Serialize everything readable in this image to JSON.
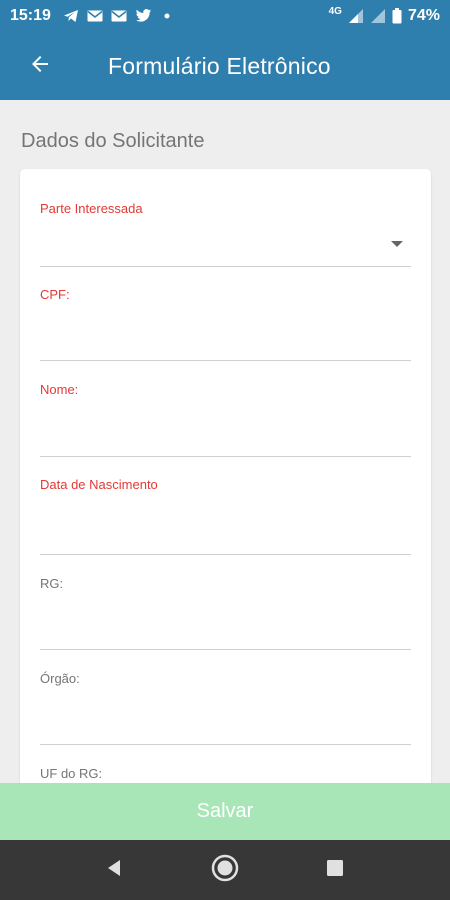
{
  "status_bar": {
    "time": "15:19",
    "network": "4G",
    "battery": "74%",
    "notification_icons": [
      "telegram-icon",
      "mail-icon",
      "mail-icon",
      "twitter-icon",
      "dot-icon"
    ]
  },
  "app_bar": {
    "title": "Formulário Eletrônico",
    "back_icon": "arrow-left-icon",
    "color": "#2f7fae"
  },
  "section": {
    "title": "Dados do Solicitante"
  },
  "fields": [
    {
      "label": "Parte Interessada",
      "value": "",
      "type": "dropdown",
      "required": true
    },
    {
      "label": "CPF:",
      "value": "",
      "type": "text",
      "required": true
    },
    {
      "label": "Nome:",
      "value": "",
      "type": "text",
      "required": true
    },
    {
      "label": "Data de Nascimento",
      "value": "",
      "type": "date",
      "required": true
    },
    {
      "label": "RG:",
      "value": "",
      "type": "text",
      "required": false
    },
    {
      "label": "Órgão:",
      "value": "",
      "type": "text",
      "required": false
    },
    {
      "label": "UF do RG:",
      "value": "",
      "type": "text",
      "required": false
    }
  ],
  "save_button": {
    "label": "Salvar",
    "color": "#a8e6b7"
  },
  "colors": {
    "required_label": "#e53935",
    "optional_label": "#757575"
  },
  "nav_bar": {
    "buttons": [
      "back-triangle-icon",
      "home-circle-icon",
      "recents-square-icon"
    ]
  }
}
